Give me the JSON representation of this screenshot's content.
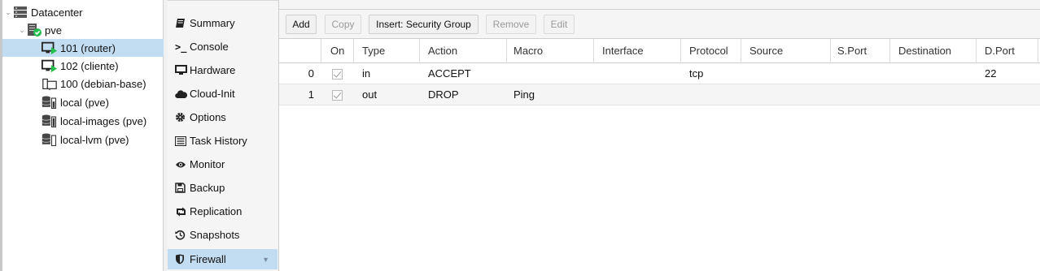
{
  "tree": {
    "items": [
      {
        "label": "Datacenter",
        "icon": "datacenter-icon",
        "expander": "collapse"
      },
      {
        "label": "pve",
        "icon": "node-online-icon",
        "expander": "collapse"
      },
      {
        "label": "101 (router)",
        "icon": "vm-running-icon",
        "selected": true
      },
      {
        "label": "102 (cliente)",
        "icon": "vm-running-icon"
      },
      {
        "label": "100 (debian-base)",
        "icon": "template-icon"
      },
      {
        "label": "local (pve)",
        "icon": "storage-icon"
      },
      {
        "label": "local-images (pve)",
        "icon": "storage-icon"
      },
      {
        "label": "local-lvm (pve)",
        "icon": "storage-icon"
      }
    ]
  },
  "nav": {
    "items": [
      {
        "label": "Summary",
        "icon": "book-icon"
      },
      {
        "label": "Console",
        "icon": "terminal-icon"
      },
      {
        "label": "Hardware",
        "icon": "desktop-icon"
      },
      {
        "label": "Cloud-Init",
        "icon": "cloud-icon"
      },
      {
        "label": "Options",
        "icon": "gear-icon"
      },
      {
        "label": "Task History",
        "icon": "list-icon"
      },
      {
        "label": "Monitor",
        "icon": "eye-icon"
      },
      {
        "label": "Backup",
        "icon": "floppy-icon"
      },
      {
        "label": "Replication",
        "icon": "retweet-icon"
      },
      {
        "label": "Snapshots",
        "icon": "history-icon"
      },
      {
        "label": "Firewall",
        "icon": "shield-icon",
        "active": true
      }
    ]
  },
  "toolbar": {
    "add": "Add",
    "copy": "Copy",
    "insert_security_group": "Insert: Security Group",
    "remove": "Remove",
    "edit": "Edit"
  },
  "table": {
    "columns": [
      "",
      "On",
      "Type",
      "Action",
      "Macro",
      "Interface",
      "Protocol",
      "Source",
      "S.Port",
      "Destination",
      "D.Port"
    ],
    "rows": [
      {
        "pos": "0",
        "on": true,
        "type": "in",
        "action": "ACCEPT",
        "macro": "",
        "interface": "",
        "protocol": "tcp",
        "source": "",
        "sport": "",
        "destination": "",
        "dport": "22"
      },
      {
        "pos": "1",
        "on": true,
        "type": "out",
        "action": "DROP",
        "macro": "Ping",
        "interface": "",
        "protocol": "",
        "source": "",
        "sport": "",
        "destination": "",
        "dport": ""
      }
    ]
  },
  "colors": {
    "selection": "#c2ddf2",
    "running_green": "#21bf4b",
    "icon_dark": "#333333"
  }
}
